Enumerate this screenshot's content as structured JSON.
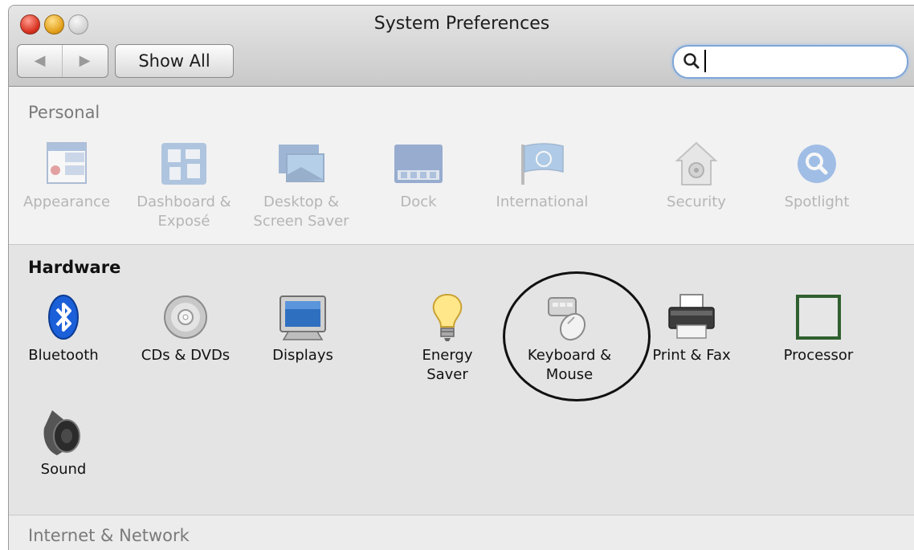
{
  "window": {
    "title": "System Preferences"
  },
  "toolbar": {
    "back": "◀",
    "forward": "▶",
    "show_all": "Show All"
  },
  "search": {
    "value": "",
    "placeholder": ""
  },
  "personal": {
    "title": "Personal",
    "items": [
      {
        "label": "Appearance",
        "icon": "appearance-icon"
      },
      {
        "label": "Dashboard &\nExposé",
        "icon": "dashboard-expose-icon"
      },
      {
        "label": "Desktop &\nScreen Saver",
        "icon": "desktop-screensaver-icon"
      },
      {
        "label": "Dock",
        "icon": "dock-icon"
      },
      {
        "label": "International",
        "icon": "international-flag-icon"
      },
      {
        "label": "Security",
        "icon": "security-house-icon"
      },
      {
        "label": "Spotlight",
        "icon": "spotlight-icon"
      }
    ]
  },
  "hardware": {
    "title": "Hardware",
    "items": [
      {
        "label": "Bluetooth",
        "icon": "bluetooth-icon"
      },
      {
        "label": "CDs & DVDs",
        "icon": "cd-dvd-icon"
      },
      {
        "label": "Displays",
        "icon": "display-icon"
      },
      {
        "label": "Energy\nSaver",
        "icon": "lightbulb-icon"
      },
      {
        "label": "Keyboard &\nMouse",
        "icon": "keyboard-mouse-icon"
      },
      {
        "label": "Print & Fax",
        "icon": "printer-icon"
      },
      {
        "label": "Processor",
        "icon": "processor-icon"
      },
      {
        "label": "Sound",
        "icon": "speaker-icon"
      }
    ]
  },
  "internet": {
    "title": "Internet & Network"
  },
  "colors": {
    "search_focus": "#7fa6d7",
    "annotation": "#111111"
  }
}
